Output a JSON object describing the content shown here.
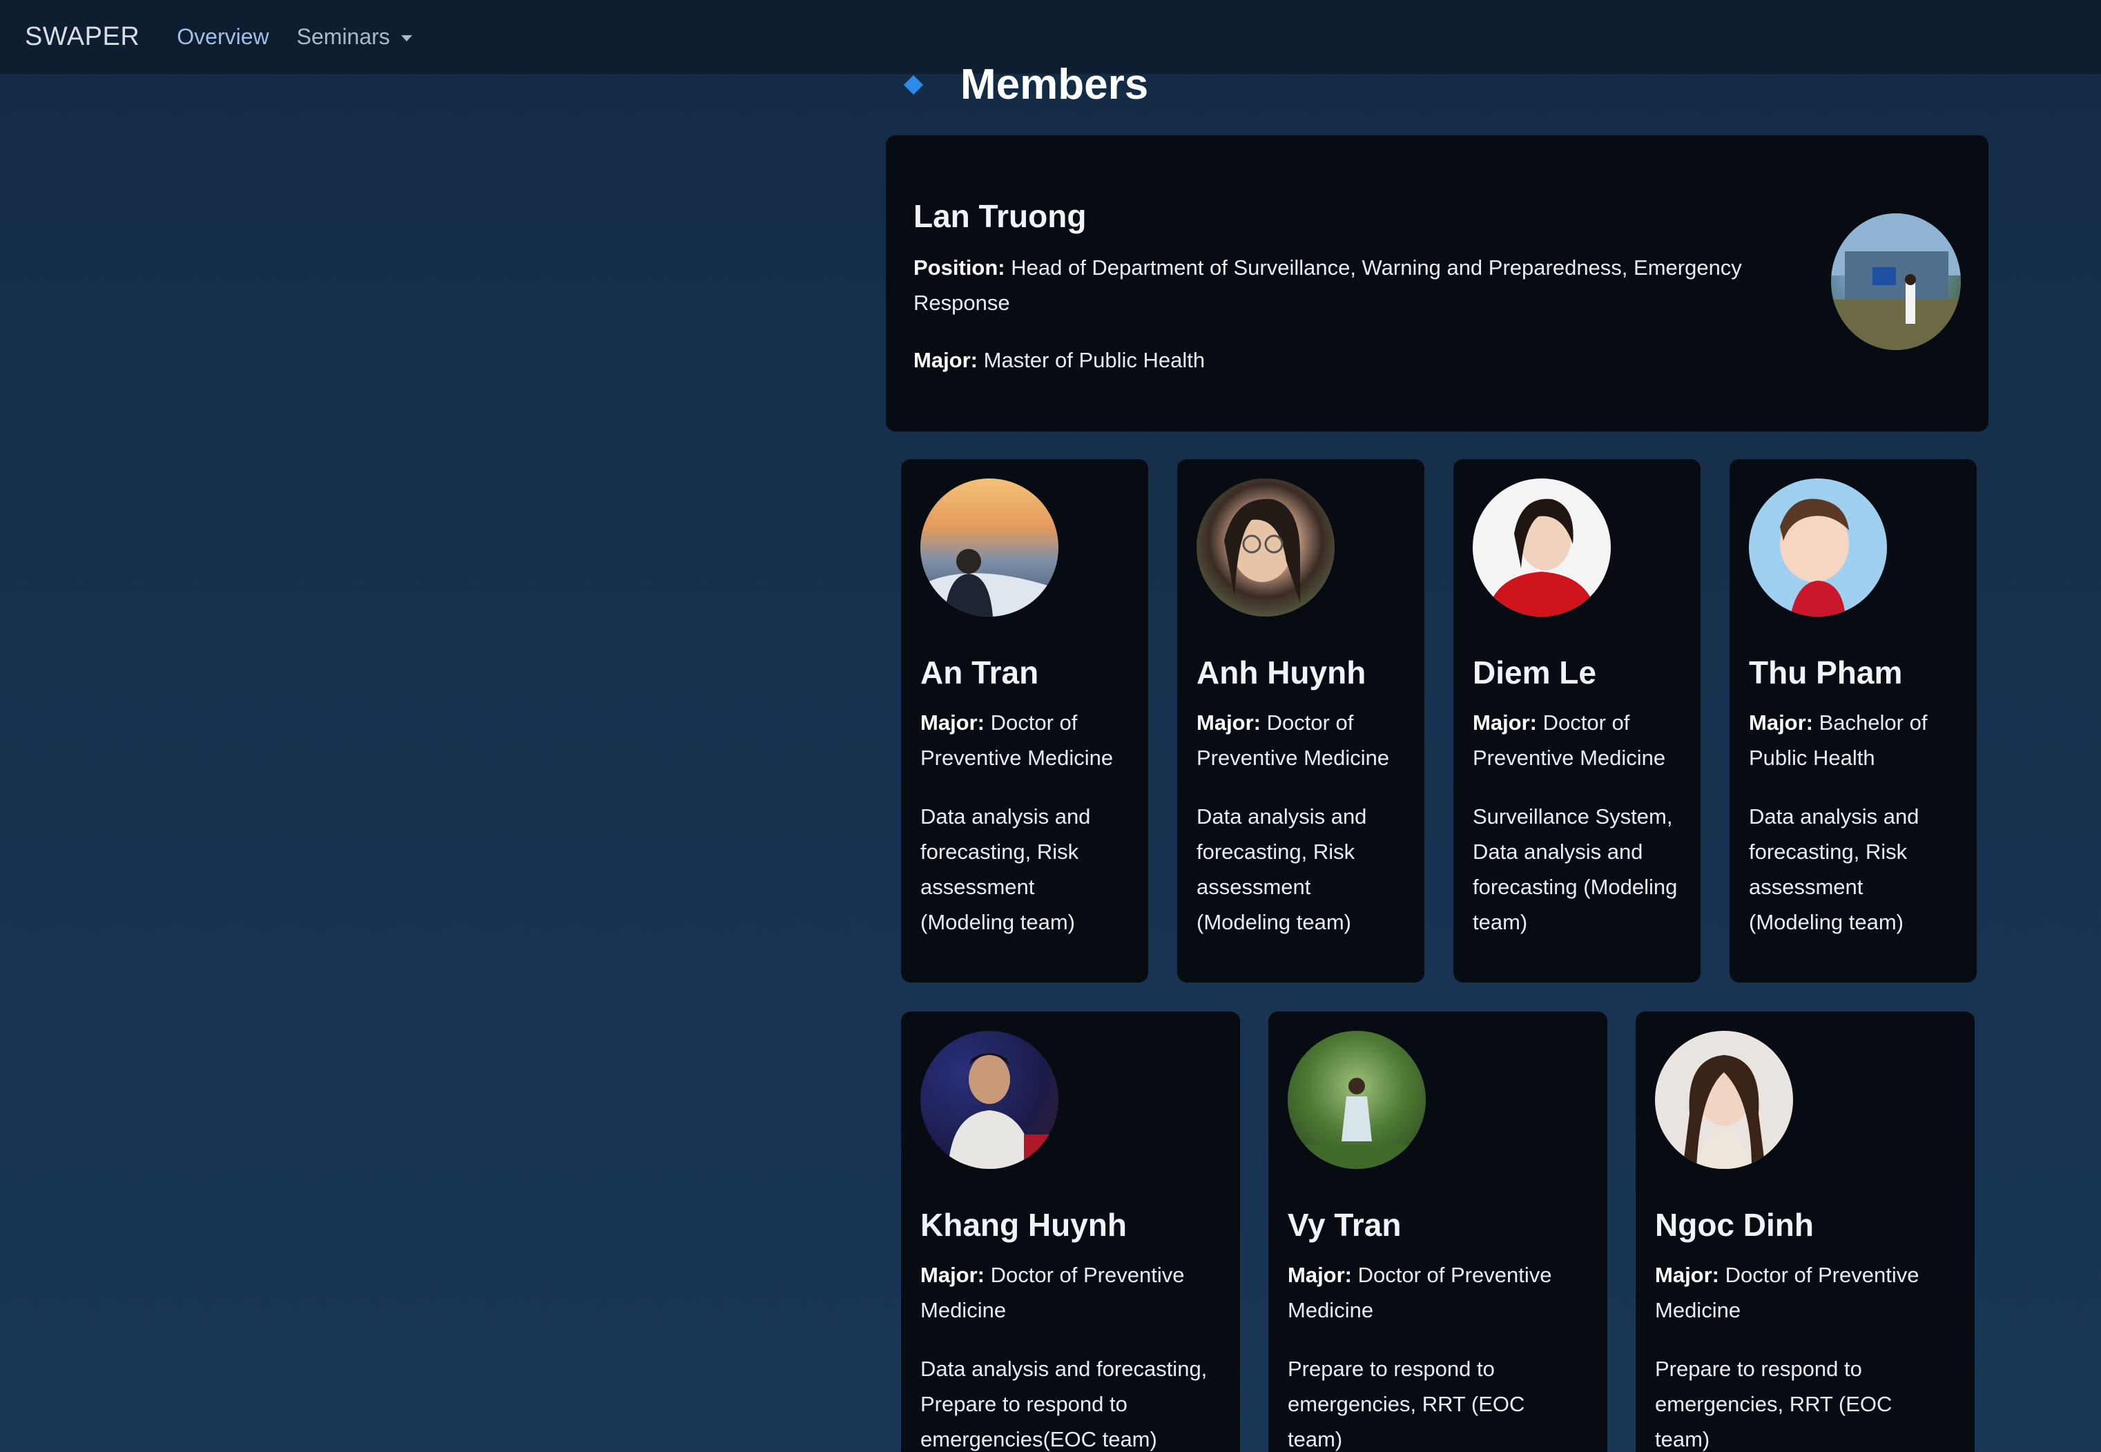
{
  "navbar": {
    "brand": "SWAPER",
    "links": [
      {
        "label": "Overview"
      },
      {
        "label": "Seminars"
      }
    ]
  },
  "section": {
    "title": "Members"
  },
  "lead": {
    "name": "Lan Truong",
    "position_label": "Position:",
    "position": "Head of Department of Surveillance, Warning and Preparedness, Emergency Response",
    "major_label": "Major:",
    "major": "Master of Public Health"
  },
  "members": [
    {
      "name": "An Tran",
      "major_label": "Major:",
      "major": "Doctor of Preventive Medicine",
      "description": "Data analysis and forecasting, Risk assessment (Modeling team)"
    },
    {
      "name": "Anh Huynh",
      "major_label": "Major:",
      "major": "Doctor of Preventive Medicine",
      "description": "Data analysis and forecasting, Risk assessment (Modeling team)"
    },
    {
      "name": "Diem Le",
      "major_label": "Major:",
      "major": "Doctor of Preventive Medicine",
      "description": "Surveillance System, Data analysis and forecasting (Modeling team)"
    },
    {
      "name": "Thu Pham",
      "major_label": "Major:",
      "major": "Bachelor of Public Health",
      "description": "Data analysis and forecasting, Risk assessment (Modeling team)"
    },
    {
      "name": "Khang Huynh",
      "major_label": "Major:",
      "major": "Doctor of Preventive Medicine",
      "description": "Data analysis and forecasting, Prepare to respond to emergencies(EOC team)"
    },
    {
      "name": "Vy Tran",
      "major_label": "Major:",
      "major": "Doctor of Preventive Medicine",
      "description": "Prepare to respond to emergencies, RRT (EOC team)"
    },
    {
      "name": "Ngoc Dinh",
      "major_label": "Major:",
      "major": "Doctor of Preventive Medicine",
      "description": "Prepare to respond to emergencies, RRT (EOC team)"
    }
  ]
}
